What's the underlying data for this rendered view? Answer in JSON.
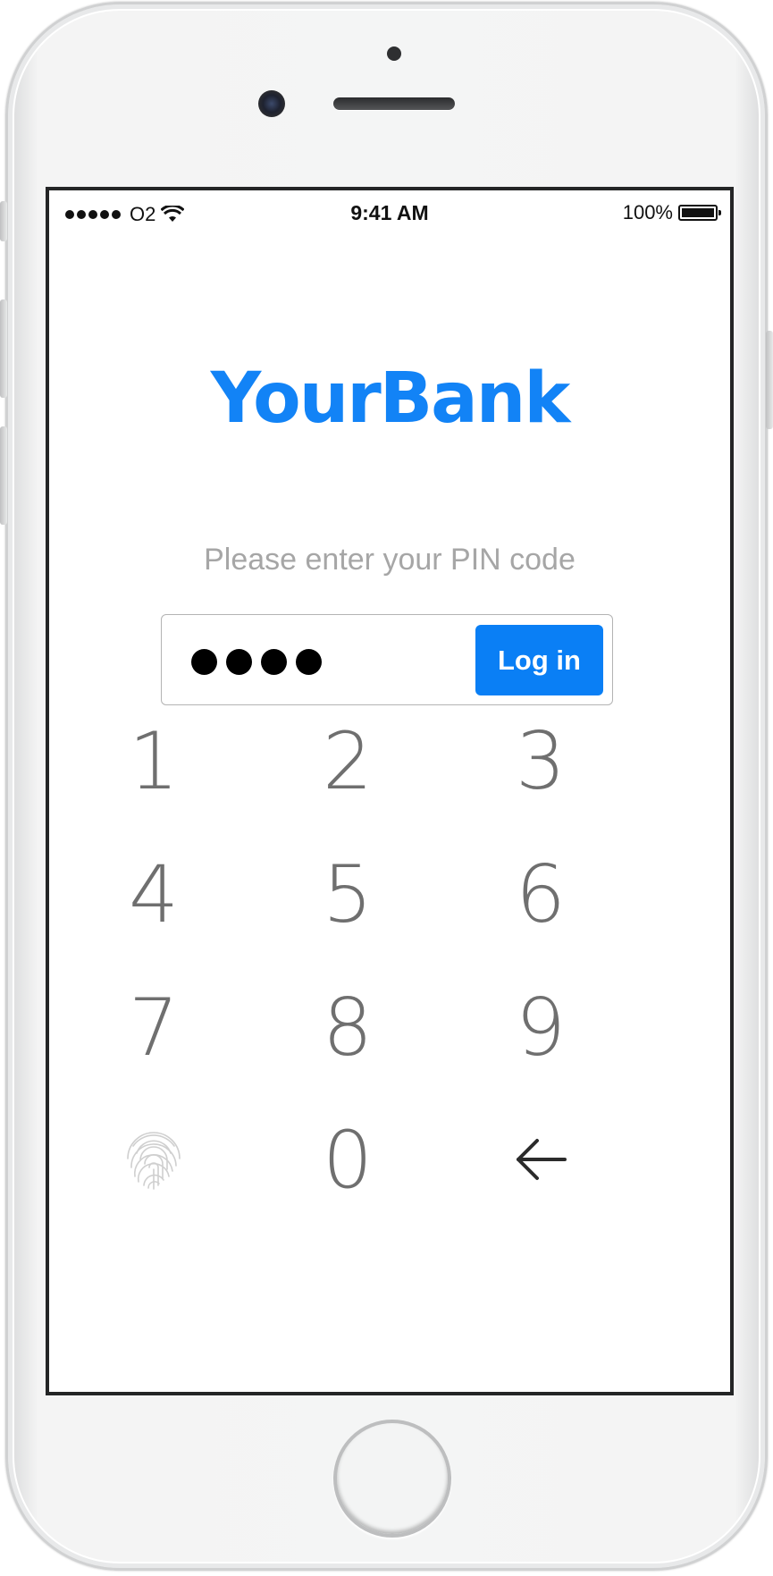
{
  "status_bar": {
    "carrier": "O2",
    "time": "9:41 AM",
    "battery": "100%"
  },
  "app": {
    "logo": "YourBank",
    "prompt": "Please enter your PIN code",
    "pin_mask": "●●●●",
    "login_label": "Log in",
    "brand_color": "#1283f6"
  },
  "keypad": {
    "keys": [
      "1",
      "2",
      "3",
      "4",
      "5",
      "6",
      "7",
      "8",
      "9",
      "0"
    ],
    "fingerprint_icon": "fingerprint-icon",
    "backspace_icon": "arrow-left-icon"
  }
}
